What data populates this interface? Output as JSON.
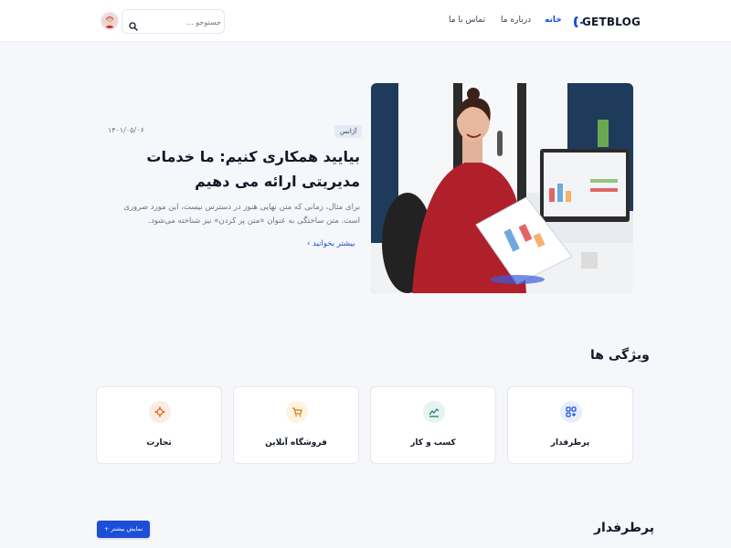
{
  "header": {
    "logo_text": "GETBLOG",
    "nav": {
      "home": "خانه",
      "about": "درباره ما",
      "contact": "تماس با ما"
    },
    "search_placeholder": "جستوجو ...",
    "search_icon": "search-icon",
    "avatar_icon": "user-avatar"
  },
  "hero": {
    "tag": "آژانس",
    "date": "۱۴۰۱/۰۵/۰۶",
    "title": "بیایید همکاری کنیم: ما خدمات مدیریتی ارائه می دهیم",
    "description": "برای مثال، زمانی که متن نهایی هنوز در دسترس نیست، این مورد ضروری است. متن ساختگی به عنوان «متن پر کردن» نیز شناخته می‌شود.",
    "read_more": "بیشتر بخوانید ›"
  },
  "features": {
    "title": "ویژگی ها",
    "items": [
      {
        "label": "پرطرفدار",
        "icon": "grid-apps-icon",
        "color": "#1d4ed8",
        "bg": "#e8eefb"
      },
      {
        "label": "کسب و کار",
        "icon": "chart-line-icon",
        "color": "#0f766e",
        "bg": "#e6f4f1"
      },
      {
        "label": "فروشگاه آنلاین",
        "icon": "cart-icon",
        "color": "#d97706",
        "bg": "#fdf3e1"
      },
      {
        "label": "تجارت",
        "icon": "network-icon",
        "color": "#ea580c",
        "bg": "#fdece4"
      }
    ]
  },
  "portfolio": {
    "title": "پرطرفدار",
    "button": "نمایش بیشتر +"
  },
  "colors": {
    "accent": "#1d4ed8",
    "background": "#f5f7fa"
  }
}
